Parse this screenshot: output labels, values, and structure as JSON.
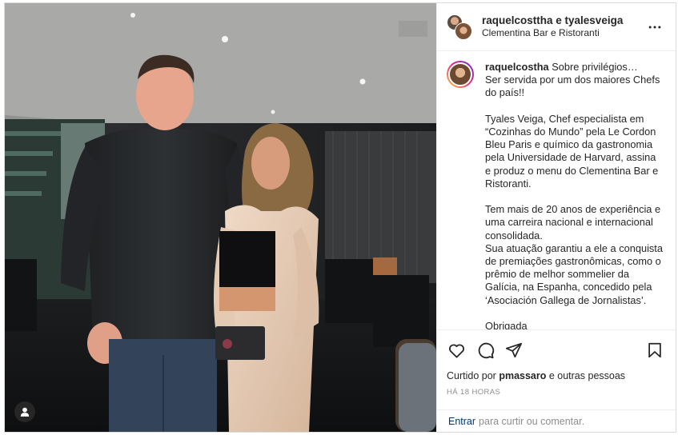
{
  "header": {
    "usernames": "raquelcosttha e tyalesveiga",
    "location": "Clementina Bar e Ristoranti",
    "more_icon": "more-horizontal-icon"
  },
  "caption": {
    "username": "raquelcostha",
    "text": " Sobre privilégios…\nSer servida por um dos maiores Chefs do país!!\n\nTyales Veiga, Chef especialista em “Cozinhas do Mundo” pela Le Cordon Bleu Paris e químico da gastronomia pela Universidade de Harvard, assina e produz o menu do Clementina Bar e Ristoranti.\n\nTem mais de 20 anos de experiência e uma carreira nacional e internacional consolidada.\nSua atuação garantiu a ele a conquista de premiações gastronômicas, como o prêmio de melhor sommelier da Galícia, na Espanha, concedido pela ‘Asociación Gallega de Jornalistas’.\n\nObrigada"
  },
  "actions": {
    "like_icon": "heart-icon",
    "comment_icon": "comment-icon",
    "share_icon": "share-icon",
    "save_icon": "bookmark-icon"
  },
  "likes": {
    "prefix": "Curtido por ",
    "user": "pmassaro",
    "suffix": " e outras pessoas"
  },
  "timestamp": "HÁ 18 HORAS",
  "comment_bar": {
    "link": "Entrar",
    "text": "para curtir ou comentar."
  },
  "photo": {
    "tag_icon": "user-tag-icon"
  },
  "colors": {
    "text": "#262626",
    "muted": "#8e8e8e",
    "link": "#00376b",
    "border": "#dbdbdb"
  }
}
